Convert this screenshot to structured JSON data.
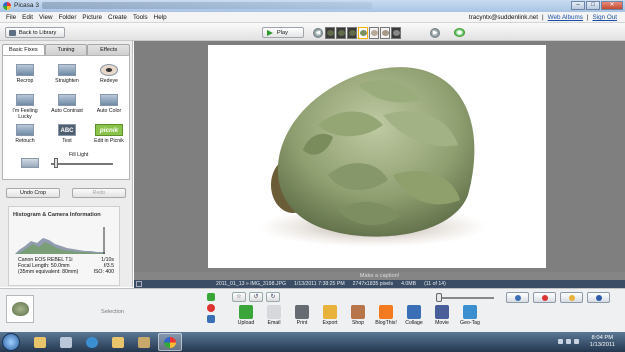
{
  "window": {
    "title": "Picasa 3"
  },
  "menu": [
    "File",
    "Edit",
    "View",
    "Folder",
    "Picture",
    "Create",
    "Tools",
    "Help"
  ],
  "account": {
    "email": "tracyntx@suddenlink.net",
    "sep1": "|",
    "web_albums": "Web Albums",
    "sep2": "|",
    "sign_out": "Sign Out"
  },
  "toolbar": {
    "back_label": "Back to Library",
    "play_label": "Play"
  },
  "tabs": [
    "Basic Fixes",
    "Tuning",
    "Effects"
  ],
  "tools": [
    {
      "label": "Recrop",
      "icon": "crop-icon"
    },
    {
      "label": "Straighten",
      "icon": "straighten-icon"
    },
    {
      "label": "Redeye",
      "icon": "eye-icon"
    },
    {
      "label": "I'm Feeling Lucky",
      "icon": "lucky-icon"
    },
    {
      "label": "Auto Contrast",
      "icon": "contrast-icon"
    },
    {
      "label": "Auto Color",
      "icon": "color-icon"
    },
    {
      "label": "Retouch",
      "icon": "retouch-icon"
    },
    {
      "label": "Text",
      "icon": "text-icon",
      "glyph": "ABC"
    },
    {
      "label": "Edit in Picnik",
      "icon": "picnik-icon",
      "glyph": "picnik"
    }
  ],
  "fill_light": {
    "label": "Fill Light",
    "level": 0.05
  },
  "undo_label": "Undo Crop",
  "redo_label": "Redo",
  "histogram": {
    "title": "Histogram & Camera Information",
    "exif": [
      {
        "k": "Canon EOS REBEL T1i",
        "v": "1/10s"
      },
      {
        "k": "Focal Length: 50.0mm",
        "v": "f/3.5"
      },
      {
        "k": "(35mm equivalent: 80mm)",
        "v": "ISO: 400"
      }
    ]
  },
  "caption_placeholder": "Make a caption!",
  "status": {
    "date": "2011_01_13 » IMG_3198.JPG",
    "time": "1/13/2011 7:38:25 PM",
    "dims": "2747x1835 pixels",
    "size": "4.0MB",
    "index": "(11 of 14)"
  },
  "tray": {
    "selection_label": "Selection"
  },
  "actions": [
    {
      "label": "Upload",
      "color": "#3aa63a"
    },
    {
      "label": "Email",
      "color": "#d6d8dc"
    },
    {
      "label": "Print",
      "color": "#666b73"
    },
    {
      "label": "Export",
      "color": "#e8b23a"
    },
    {
      "label": "Shop",
      "color": "#b8744a"
    },
    {
      "label": "BlogThis!",
      "color": "#f47a20"
    },
    {
      "label": "Collage",
      "color": "#3b6fb5"
    },
    {
      "label": "Movie",
      "color": "#4a5f99"
    },
    {
      "label": "Geo-Tag",
      "color": "#3a8fd0"
    }
  ],
  "clock": {
    "time": "8:04 PM",
    "date": "1/13/2011"
  }
}
